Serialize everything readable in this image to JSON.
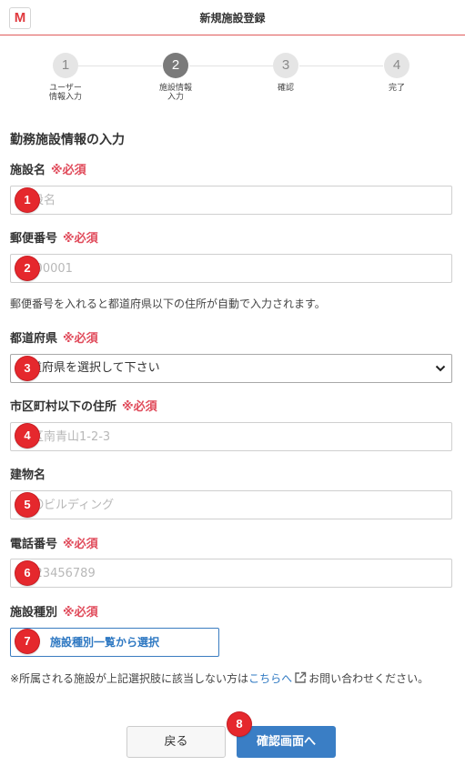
{
  "header": {
    "logo": "M",
    "title": "新規施設登録"
  },
  "steps": [
    {
      "number": "1",
      "label": "ユーザー\n情報入力"
    },
    {
      "number": "2",
      "label": "施設情報\n入力"
    },
    {
      "number": "3",
      "label": "確認"
    },
    {
      "number": "4",
      "label": "完了"
    }
  ],
  "active_step": 2,
  "section_title": "勤務施設情報の入力",
  "required_mark": "※必須",
  "fields": {
    "facility_name": {
      "label": "施設名",
      "placeholder": "施設名"
    },
    "postal_code": {
      "label": "郵便番号",
      "placeholder": "1000001"
    },
    "postal_note": "郵便番号を入れると都道府県以下の住所が自動で入力されます。",
    "prefecture": {
      "label": "都道府県",
      "selected": "都道府県を選択して下さい"
    },
    "address": {
      "label": "市区町村以下の住所",
      "placeholder": "港区南青山1-2-3"
    },
    "building": {
      "label": "建物名",
      "placeholder": "〇〇ビルディング"
    },
    "phone": {
      "label": "電話番号",
      "placeholder": "0123456789"
    },
    "facility_type": {
      "label": "施設種別",
      "button": "施設種別一覧から選択"
    }
  },
  "contact_note": {
    "before": "※所属される施設が上記選択肢に該当しない方は",
    "link": "こちらへ",
    "after": "お問い合わせください。"
  },
  "buttons": {
    "back": "戻る",
    "confirm": "確認画面へ"
  },
  "annotations": [
    "1",
    "2",
    "3",
    "4",
    "5",
    "6",
    "7",
    "8"
  ],
  "colors": {
    "accent": "#e05a5a",
    "required": "#e04a5a",
    "link": "#2e78c2",
    "primary": "#3a7ec5",
    "badge": "#e5282d"
  }
}
